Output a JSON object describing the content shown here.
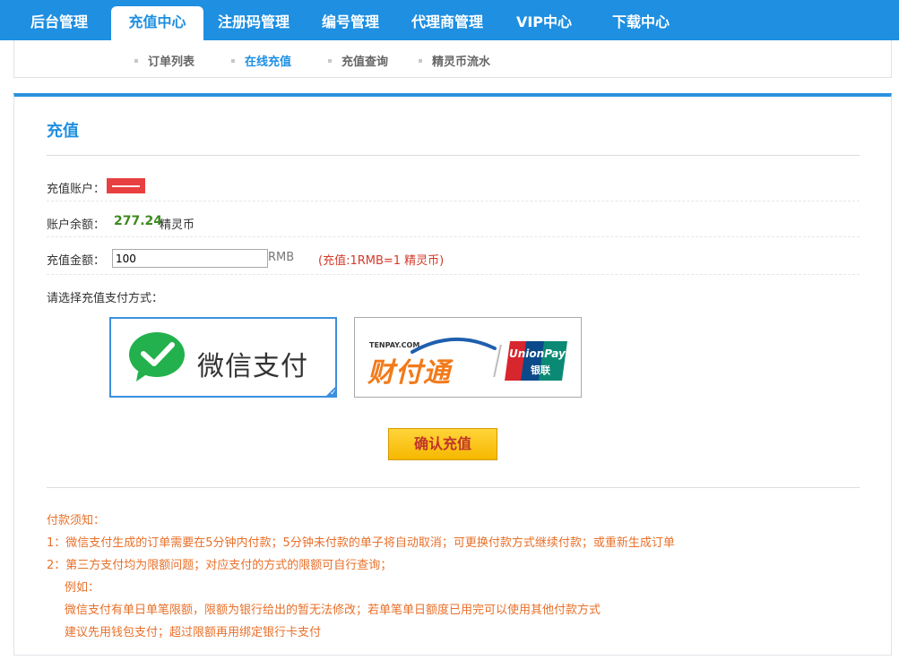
{
  "topnav": {
    "tabs": [
      {
        "label": "后台管理",
        "active": false
      },
      {
        "label": "充值中心",
        "active": true
      },
      {
        "label": "注册码管理",
        "active": false
      },
      {
        "label": "编号管理",
        "active": false
      },
      {
        "label": "代理商管理",
        "active": false
      },
      {
        "label": "VIP中心",
        "active": false
      },
      {
        "label": "下载中心",
        "active": false
      }
    ]
  },
  "subnav": {
    "items": [
      {
        "label": "订单列表",
        "active": false
      },
      {
        "label": "在线充值",
        "active": true
      },
      {
        "label": "充值查询",
        "active": false
      },
      {
        "label": "精灵币流水",
        "active": false
      }
    ]
  },
  "panel": {
    "title": "充值",
    "account_label": "充值账户：",
    "balance_label": "账户余额：",
    "balance_value": "277.24",
    "balance_unit": "精灵币",
    "amount_label": "充值金额：",
    "amount_value": "100",
    "amount_unit": "RMB",
    "rate_note": "(充值:1RMB=1 精灵币)",
    "pay_method_label": "请选择充值支付方式：",
    "payment_options": [
      {
        "name": "wechat",
        "text": "微信支付",
        "selected": true
      },
      {
        "name": "tenpay",
        "text": "财付通",
        "small_text": "TENPAY.COM",
        "badge_text": "UnionPay",
        "badge_text2": "银联",
        "selected": false
      }
    ],
    "confirm_label": "确认充值",
    "notice": [
      "付款须知：",
      "1：微信支付生成的订单需要在5分钟内付款；5分钟未付款的单子将自动取消；可更换付款方式继续付款；或重新生成订单",
      "2：第三方支付均为限额问题；对应支付的方式的限额可自行查询；",
      "例如：",
      "微信支付有单日单笔限额，限额为银行给出的暂无法修改；若单笔单日额度已用完可以使用其他付款方式",
      "建议先用钱包支付；超过限额再用绑定银行卡支付"
    ]
  },
  "colors": {
    "brand_blue": "#1e8fe1",
    "balance_green": "#3d8a20",
    "notice_orange": "#e8702a",
    "rate_red": "#d33a2a",
    "button_yellow": "#ffd43a"
  }
}
